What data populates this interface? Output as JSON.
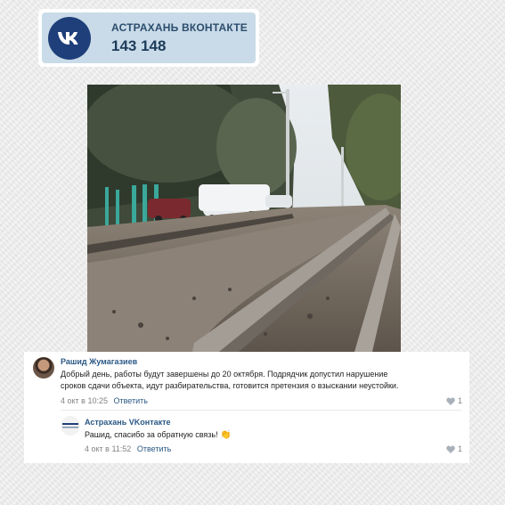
{
  "header": {
    "title": "АСТРАХАНЬ ВКОНТАКТЕ",
    "count": "143 148",
    "logo_icon": "vk-logo-icon",
    "accent": "#1f3f7a",
    "bg": "#c9dbe8"
  },
  "photo": {
    "description_icon": "road-construction-photo"
  },
  "comments": [
    {
      "author": "Рашид Жумагазиев",
      "text_line1": "Добрый день, работы будут завершены до 20 октября. Подрядчик допустил нарушение",
      "text_line2": "сроков сдачи объекта, идут разбирательства, готовится претензия о взыскании неустойки.",
      "date": "4 окт в 10:25",
      "reply": "Ответить",
      "likes": "1"
    },
    {
      "author": "Астрахань VKонтакте",
      "text": "Рашид, спасибо за обратную связь!",
      "emoji": "👏",
      "date": "4 окт в 11:52",
      "reply": "Ответить",
      "likes": "1"
    }
  ]
}
